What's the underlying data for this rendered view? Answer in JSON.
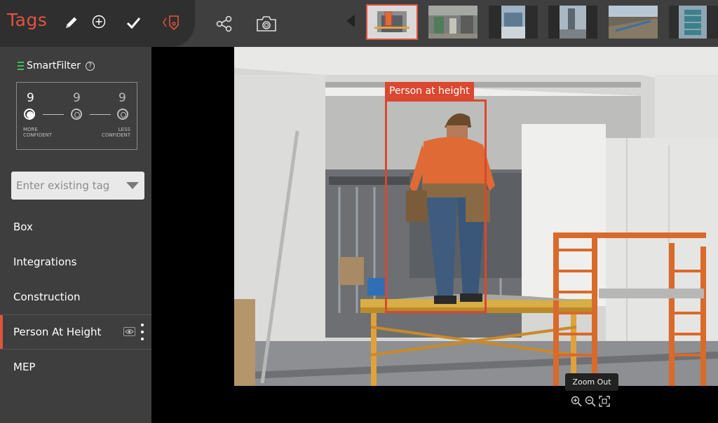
{
  "header": {
    "title": "Tags",
    "icons": [
      "pencil-icon",
      "add-circle-icon",
      "check-icon",
      "tag-code-icon",
      "share-icon",
      "camera-icon"
    ]
  },
  "thumbnails": {
    "count": 6,
    "active_index": 0
  },
  "smart_filter": {
    "label": "SmartFilter",
    "help": "?",
    "levels": [
      "9",
      "9",
      "9"
    ],
    "selected_level": 0,
    "more_label": "MORE\nCONFIDENT",
    "less_label": "LESS\nCONFIDENT"
  },
  "tag_input": {
    "placeholder": "Enter existing tag"
  },
  "tags": [
    {
      "label": "Box"
    },
    {
      "label": "Integrations"
    },
    {
      "label": "Construction"
    },
    {
      "label": "Person At Height"
    },
    {
      "label": "MEP"
    }
  ],
  "active_tag_index": 3,
  "viewer": {
    "detection_label": "Person at height",
    "tooltip": "Zoom Out"
  },
  "colors": {
    "accent": "#e0533f",
    "smartfilter_icon": "#3fbf5a"
  }
}
